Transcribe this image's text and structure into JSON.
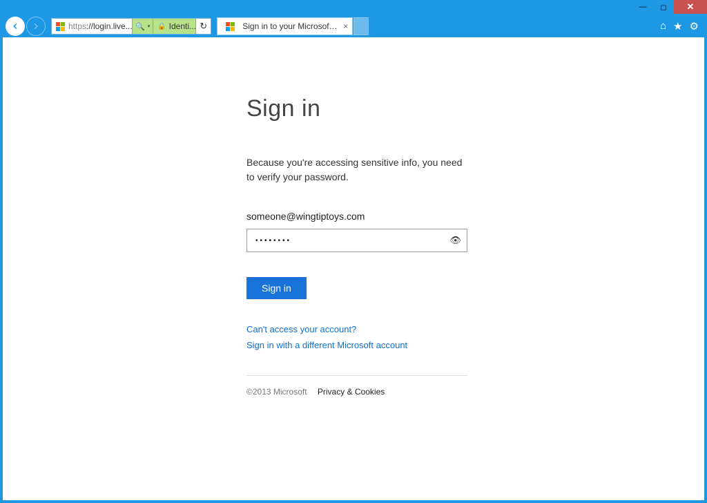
{
  "window": {
    "minimize_glyph": "—",
    "maximize_glyph": "◻",
    "close_glyph": "✕"
  },
  "toolbar": {
    "url_prefix": "https",
    "url_rest": "://login.live....",
    "identified_label": "Identi...",
    "tab_title": "Sign in to your Microsoft ac...",
    "home_glyph": "⌂",
    "star_glyph": "★",
    "gear_glyph": "⚙",
    "refresh_glyph": "↻",
    "search_glyph": "🔍",
    "dropdown_glyph": "▾",
    "lock_glyph": "🔒",
    "close_tab_glyph": "×"
  },
  "page": {
    "heading": "Sign in",
    "explain": "Because you're accessing sensitive info, you need to verify your password.",
    "email": "someone@wingtiptoys.com",
    "password_mask": "••••••••",
    "reveal_glyph": "👁",
    "signin_label": "Sign in",
    "link_cant_access": "Can't access your account?",
    "link_different": "Sign in with a different Microsoft account",
    "copyright": "©2013 Microsoft",
    "privacy": "Privacy & Cookies"
  }
}
